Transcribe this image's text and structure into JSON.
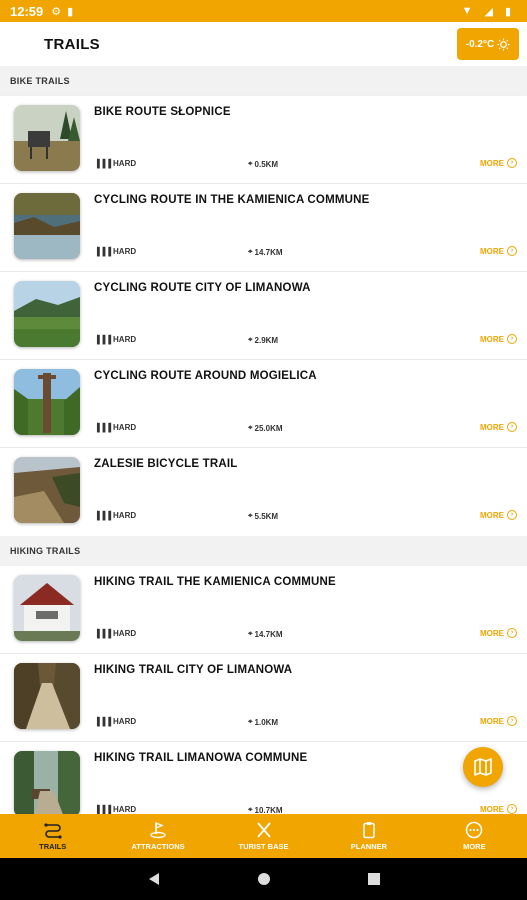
{
  "status_bar": {
    "time": "12:59"
  },
  "app_bar": {
    "title": "TRAILS",
    "weather": "-0.2°C"
  },
  "sections": [
    {
      "header": "BIKE TRAILS",
      "items": [
        {
          "title": "BIKE ROUTE SŁOPNICE",
          "difficulty": "HARD",
          "distance": "0.5KM",
          "more": "MORE"
        },
        {
          "title": "CYCLING ROUTE IN THE KAMIENICA COMMUNE",
          "difficulty": "HARD",
          "distance": "14.7KM",
          "more": "MORE"
        },
        {
          "title": "CYCLING ROUTE CITY OF LIMANOWA",
          "difficulty": "HARD",
          "distance": "2.9KM",
          "more": "MORE"
        },
        {
          "title": "CYCLING ROUTE AROUND MOGIELICA",
          "difficulty": "HARD",
          "distance": "25.0KM",
          "more": "MORE"
        },
        {
          "title": "ZALESIE BICYCLE TRAIL",
          "difficulty": "HARD",
          "distance": "5.5KM",
          "more": "MORE"
        }
      ]
    },
    {
      "header": "HIKING TRAILS",
      "items": [
        {
          "title": "HIKING TRAIL THE KAMIENICA COMMUNE",
          "difficulty": "HARD",
          "distance": "14.7KM",
          "more": "MORE"
        },
        {
          "title": "HIKING TRAIL CITY OF LIMANOWA",
          "difficulty": "HARD",
          "distance": "1.0KM",
          "more": "MORE"
        },
        {
          "title": "HIKING TRAIL LIMANOWA COMMUNE",
          "difficulty": "HARD",
          "distance": "10.7KM",
          "more": "MORE"
        }
      ]
    }
  ],
  "bottom_nav": [
    {
      "label": "TRAILS",
      "icon": "trails-icon",
      "active": true
    },
    {
      "label": "ATTRACTIONS",
      "icon": "flag-icon",
      "active": false
    },
    {
      "label": "TURIST BASE",
      "icon": "fork-knife-icon",
      "active": false
    },
    {
      "label": "PLANNER",
      "icon": "clipboard-icon",
      "active": false
    },
    {
      "label": "MORE",
      "icon": "more-icon",
      "active": false
    }
  ],
  "colors": {
    "accent": "#f0a500",
    "background": "#f2f2f2"
  }
}
